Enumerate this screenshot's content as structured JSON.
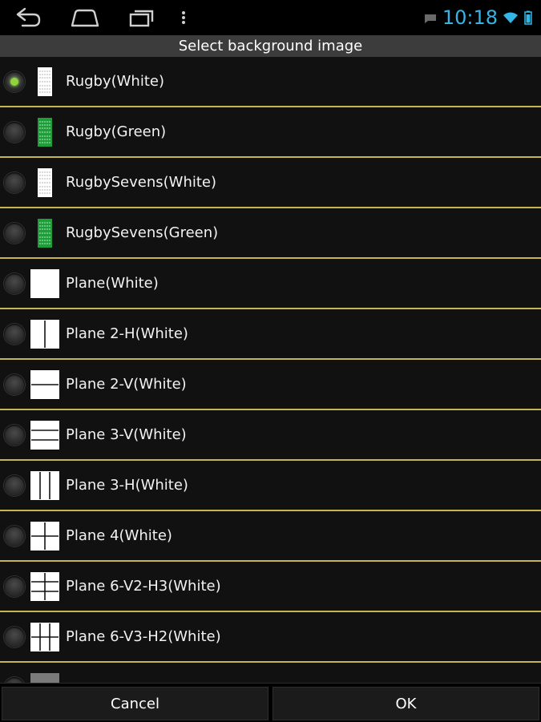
{
  "status": {
    "time": "10:18"
  },
  "dialog": {
    "title": "Select background image"
  },
  "options": [
    {
      "label": "Rugby(White)",
      "selected": true,
      "thumb": "rugby-white"
    },
    {
      "label": "Rugby(Green)",
      "selected": false,
      "thumb": "rugby-green"
    },
    {
      "label": "RugbySevens(White)",
      "selected": false,
      "thumb": "rugby-white"
    },
    {
      "label": "RugbySevens(Green)",
      "selected": false,
      "thumb": "rugby-green"
    },
    {
      "label": "Plane(White)",
      "selected": false,
      "thumb": "plane"
    },
    {
      "label": "Plane 2-H(White)",
      "selected": false,
      "thumb": "plane-2h"
    },
    {
      "label": "Plane 2-V(White)",
      "selected": false,
      "thumb": "plane-2v"
    },
    {
      "label": "Plane 3-V(White)",
      "selected": false,
      "thumb": "plane-3v"
    },
    {
      "label": "Plane 3-H(White)",
      "selected": false,
      "thumb": "plane-3h"
    },
    {
      "label": "Plane 4(White)",
      "selected": false,
      "thumb": "plane-4"
    },
    {
      "label": "Plane 6-V2-H3(White)",
      "selected": false,
      "thumb": "plane-6-v2h3"
    },
    {
      "label": "Plane 6-V3-H2(White)",
      "selected": false,
      "thumb": "plane-6-v3h2"
    },
    {
      "label": "",
      "selected": false,
      "thumb": "partial"
    }
  ],
  "buttons": {
    "cancel": "Cancel",
    "ok": "OK"
  },
  "colors": {
    "accent": "#33b5e5",
    "divider": "#c7b455",
    "radio_selected": "#8fd43c"
  }
}
